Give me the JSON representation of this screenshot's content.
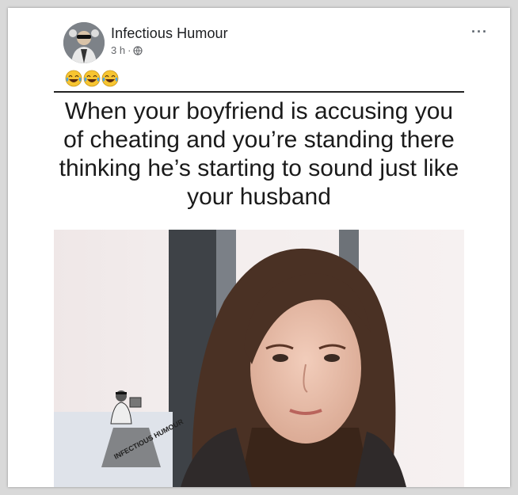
{
  "post": {
    "page_name": "Infectious Humour",
    "time": "3 h",
    "separator": "·",
    "privacy_icon": "globe-icon",
    "more_label": "···",
    "reaction_emojis": [
      "face-with-tears-of-joy-icon",
      "face-with-tears-of-joy-icon",
      "face-with-tears-of-joy-icon"
    ]
  },
  "meme": {
    "caption": "When your boyfriend is accusing you of cheating and you’re standing there thinking he’s starting to sound just like your husband",
    "watermark": "INFECTIOUS HUMOUR"
  },
  "colors": {
    "name_text": "#1c1e21",
    "meta_text": "#65676b",
    "emoji_face": "#f7c531",
    "tear": "#4fa3e0"
  }
}
